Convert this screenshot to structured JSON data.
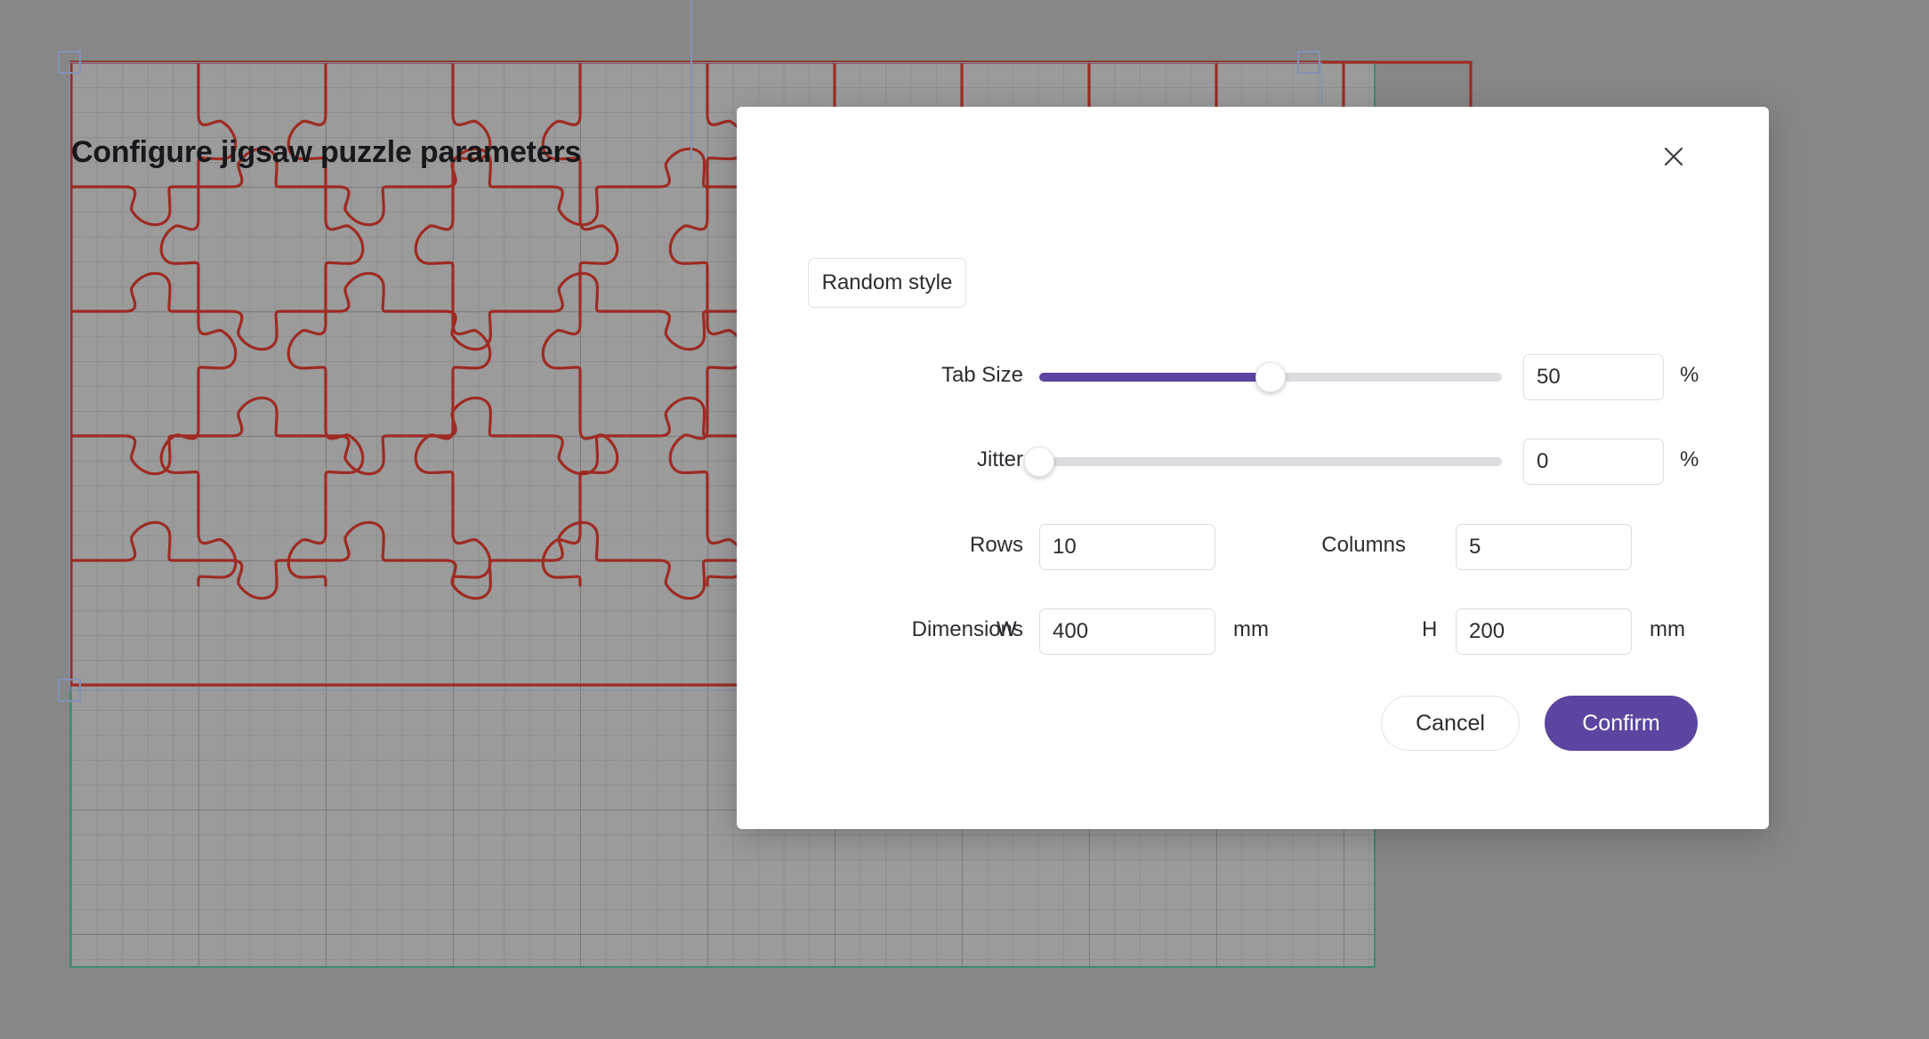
{
  "canvas": {
    "background_color": "#878787",
    "sheet_color": "#9b9b9b",
    "sheet_border_color": "#3f8a73",
    "puzzle_line_color": "#9e2b23",
    "selection_color": "#8292b8",
    "grid_label": "document-grid"
  },
  "dialog": {
    "title": "Configure jigsaw puzzle parameters",
    "close_icon": "close-icon",
    "accent_color": "#5b45a0",
    "random_style_label": "Random style",
    "controls": {
      "tab_size": {
        "label": "Tab Size",
        "value": "50",
        "unit": "%",
        "slider_percent": 50
      },
      "jitter": {
        "label": "Jitter",
        "value": "0",
        "unit": "%",
        "slider_percent": 0
      },
      "rows": {
        "label": "Rows",
        "value": "10"
      },
      "columns": {
        "label": "Columns",
        "value": "5"
      },
      "dimensions": {
        "label": "Dimensions",
        "width_label": "W",
        "width_value": "400",
        "width_unit": "mm",
        "height_label": "H",
        "height_value": "200",
        "height_unit": "mm"
      }
    },
    "footer": {
      "cancel_label": "Cancel",
      "confirm_label": "Confirm"
    }
  }
}
